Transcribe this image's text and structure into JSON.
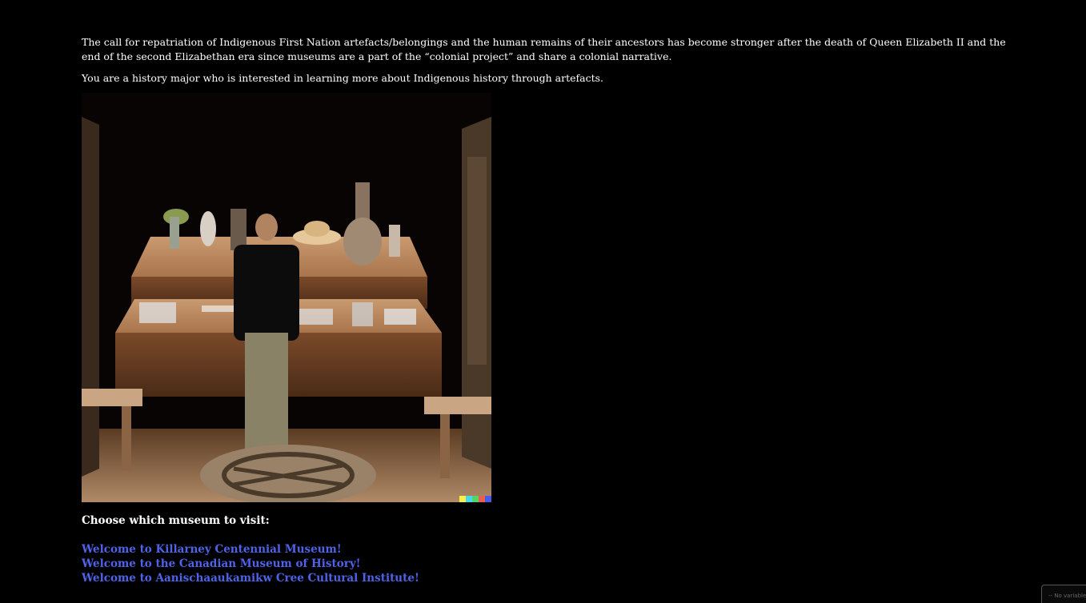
{
  "passage": {
    "paragraph_1": "The call for repatriation of Indigenous First Nation artefacts/belongings and the human remains of their ancestors has become stronger after the death of Queen Elizabeth II and the end of the second Elizabethan era since museums are a part of the “colonial project” and share a colonial narrative.",
    "paragraph_2": "You are a history major who is interested in learning more about Indigenous history through artefacts."
  },
  "scene": {
    "description_icon": "museum-scene-image"
  },
  "prompt": "Choose which museum to visit:",
  "links": [
    {
      "label": "Welcome to Killarney Centennial Museum!"
    },
    {
      "label": "Welcome to the Canadian Museum of History!"
    },
    {
      "label": "Welcome to Aanischaaukamikw Cree Cultural Institute!"
    }
  ],
  "corner_widget": {
    "label": "-- No variable"
  },
  "colors": {
    "background": "#000000",
    "text": "#ffffff",
    "link": "#4f63e8"
  }
}
